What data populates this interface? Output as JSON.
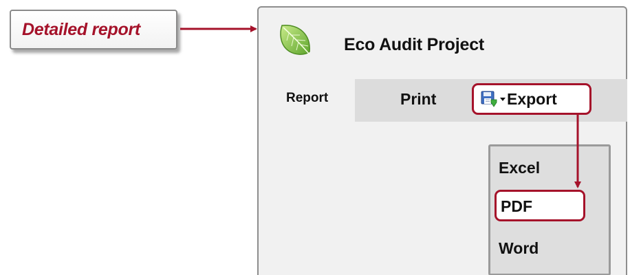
{
  "callout": {
    "text": "Detailed report"
  },
  "panel": {
    "title": "Eco Audit Project",
    "icon": "leaf-icon",
    "report_label": "Report"
  },
  "toolbar": {
    "print_label": "Print",
    "export_label": "Export",
    "export_icon": "save-icon"
  },
  "export_menu": {
    "items": [
      "Excel",
      "PDF",
      "Word"
    ],
    "highlighted": "PDF"
  },
  "colors": {
    "highlight": "#a5122a",
    "panel_bg": "#f1f1f1",
    "toolbar_bg": "#dcdcdc",
    "menu_bg": "#dedede",
    "leaf_green": "#7cc043"
  }
}
